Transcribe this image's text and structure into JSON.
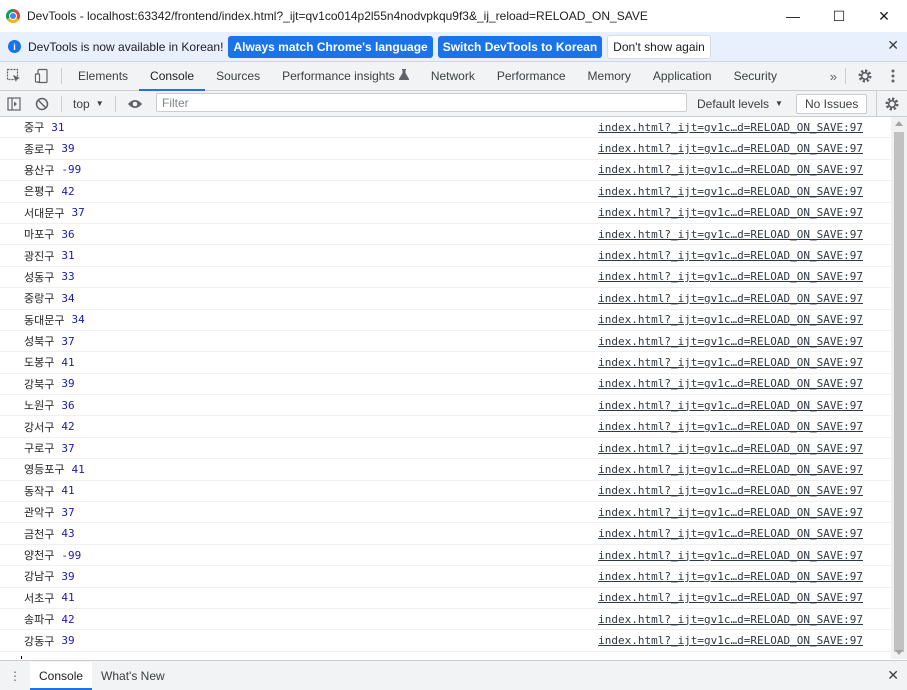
{
  "window": {
    "title": "DevTools - localhost:63342/frontend/index.html?_ijt=qv1co014p2l55n4nodvpkqu9f3&_ij_reload=RELOAD_ON_SAVE",
    "minimize": "—",
    "maximize": "☐",
    "close": "✕"
  },
  "infobar": {
    "icon": "i",
    "message": "DevTools is now available in Korean!",
    "btn_match": "Always match Chrome's language",
    "btn_switch": "Switch DevTools to Korean",
    "btn_dismiss": "Don't show again",
    "close": "✕"
  },
  "tabs": {
    "elements": "Elements",
    "console": "Console",
    "sources": "Sources",
    "performance_insights": "Performance insights",
    "network": "Network",
    "performance": "Performance",
    "memory": "Memory",
    "application": "Application",
    "security": "Security",
    "more": "»"
  },
  "console_toolbar": {
    "context": "top",
    "filter_placeholder": "Filter",
    "levels": "Default levels",
    "issues": "No Issues"
  },
  "messages": [
    {
      "district": "중구",
      "value": "31",
      "source": "index.html?_ijt=gv1c…d=RELOAD_ON_SAVE:97"
    },
    {
      "district": "종로구",
      "value": "39",
      "source": "index.html?_ijt=gv1c…d=RELOAD_ON_SAVE:97"
    },
    {
      "district": "용산구",
      "value": "-99",
      "source": "index.html?_ijt=gv1c…d=RELOAD_ON_SAVE:97"
    },
    {
      "district": "은평구",
      "value": "42",
      "source": "index.html?_ijt=gv1c…d=RELOAD_ON_SAVE:97"
    },
    {
      "district": "서대문구",
      "value": "37",
      "source": "index.html?_ijt=gv1c…d=RELOAD_ON_SAVE:97"
    },
    {
      "district": "마포구",
      "value": "36",
      "source": "index.html?_ijt=gv1c…d=RELOAD_ON_SAVE:97"
    },
    {
      "district": "광진구",
      "value": "31",
      "source": "index.html?_ijt=gv1c…d=RELOAD_ON_SAVE:97"
    },
    {
      "district": "성동구",
      "value": "33",
      "source": "index.html?_ijt=gv1c…d=RELOAD_ON_SAVE:97"
    },
    {
      "district": "중랑구",
      "value": "34",
      "source": "index.html?_ijt=gv1c…d=RELOAD_ON_SAVE:97"
    },
    {
      "district": "동대문구",
      "value": "34",
      "source": "index.html?_ijt=gv1c…d=RELOAD_ON_SAVE:97"
    },
    {
      "district": "성북구",
      "value": "37",
      "source": "index.html?_ijt=gv1c…d=RELOAD_ON_SAVE:97"
    },
    {
      "district": "도봉구",
      "value": "41",
      "source": "index.html?_ijt=gv1c…d=RELOAD_ON_SAVE:97"
    },
    {
      "district": "강북구",
      "value": "39",
      "source": "index.html?_ijt=gv1c…d=RELOAD_ON_SAVE:97"
    },
    {
      "district": "노원구",
      "value": "36",
      "source": "index.html?_ijt=gv1c…d=RELOAD_ON_SAVE:97"
    },
    {
      "district": "강서구",
      "value": "42",
      "source": "index.html?_ijt=gv1c…d=RELOAD_ON_SAVE:97"
    },
    {
      "district": "구로구",
      "value": "37",
      "source": "index.html?_ijt=gv1c…d=RELOAD_ON_SAVE:97"
    },
    {
      "district": "영등포구",
      "value": "41",
      "source": "index.html?_ijt=gv1c…d=RELOAD_ON_SAVE:97"
    },
    {
      "district": "동작구",
      "value": "41",
      "source": "index.html?_ijt=gv1c…d=RELOAD_ON_SAVE:97"
    },
    {
      "district": "관악구",
      "value": "37",
      "source": "index.html?_ijt=gv1c…d=RELOAD_ON_SAVE:97"
    },
    {
      "district": "금천구",
      "value": "43",
      "source": "index.html?_ijt=gv1c…d=RELOAD_ON_SAVE:97"
    },
    {
      "district": "양천구",
      "value": "-99",
      "source": "index.html?_ijt=gv1c…d=RELOAD_ON_SAVE:97"
    },
    {
      "district": "강남구",
      "value": "39",
      "source": "index.html?_ijt=gv1c…d=RELOAD_ON_SAVE:97"
    },
    {
      "district": "서초구",
      "value": "41",
      "source": "index.html?_ijt=gv1c…d=RELOAD_ON_SAVE:97"
    },
    {
      "district": "송파구",
      "value": "42",
      "source": "index.html?_ijt=gv1c…d=RELOAD_ON_SAVE:97"
    },
    {
      "district": "강동구",
      "value": "39",
      "source": "index.html?_ijt=gv1c…d=RELOAD_ON_SAVE:97"
    }
  ],
  "prompt": ">",
  "drawer": {
    "menu": "⋮",
    "tab_console": "Console",
    "tab_whats_new": "What's New",
    "close": "✕"
  },
  "colors": {
    "accent": "#1a73e8",
    "number": "#1a1aa6",
    "infobar_bg": "#e8f0fe",
    "toolbar_bg": "#f1f3f4"
  }
}
